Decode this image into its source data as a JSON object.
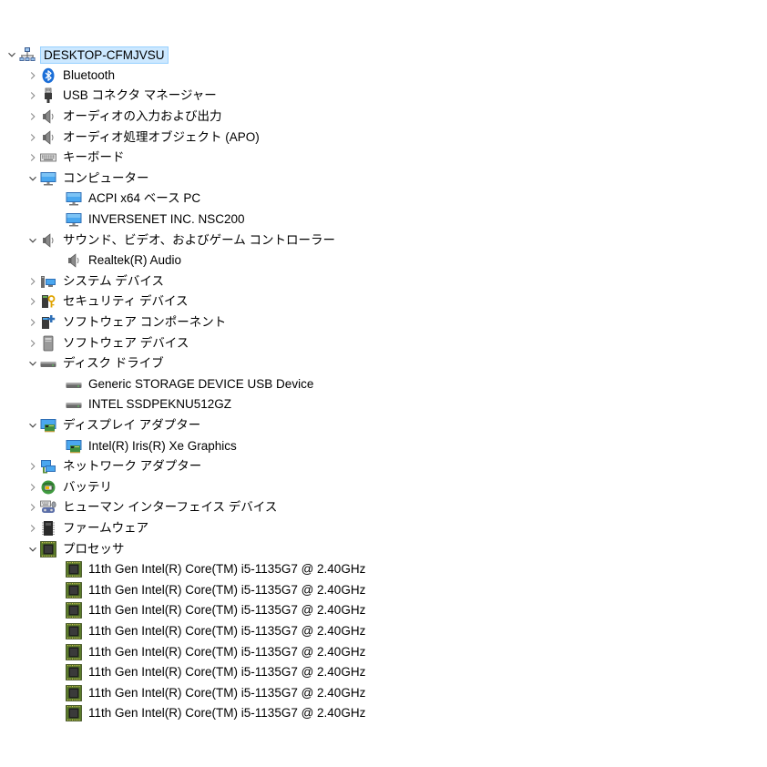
{
  "tree": {
    "root": {
      "label": "DESKTOP-CFMJVSU",
      "icon": "computer-network-icon",
      "expanded": true
    },
    "nodes": [
      {
        "label": "Bluetooth",
        "icon": "bluetooth-icon",
        "expanded": false,
        "children": []
      },
      {
        "label": "USB コネクタ マネージャー",
        "icon": "usb-connector-icon",
        "expanded": false,
        "children": []
      },
      {
        "label": "オーディオの入力および出力",
        "icon": "speaker-icon",
        "expanded": false,
        "children": []
      },
      {
        "label": "オーディオ処理オブジェクト (APO)",
        "icon": "speaker-icon",
        "expanded": false,
        "children": []
      },
      {
        "label": "キーボード",
        "icon": "keyboard-icon",
        "expanded": false,
        "children": []
      },
      {
        "label": "コンピューター",
        "icon": "monitor-icon",
        "expanded": true,
        "children": [
          {
            "label": "ACPI x64 ベース PC",
            "icon": "monitor-icon"
          },
          {
            "label": "INVERSENET INC. NSC200",
            "icon": "monitor-icon"
          }
        ]
      },
      {
        "label": "サウンド、ビデオ、およびゲーム コントローラー",
        "icon": "speaker-icon",
        "expanded": true,
        "children": [
          {
            "label": "Realtek(R) Audio",
            "icon": "speaker-icon"
          }
        ]
      },
      {
        "label": "システム デバイス",
        "icon": "system-devices-icon",
        "expanded": false,
        "children": []
      },
      {
        "label": "セキュリティ デバイス",
        "icon": "security-device-icon",
        "expanded": false,
        "children": []
      },
      {
        "label": "ソフトウェア コンポーネント",
        "icon": "software-component-icon",
        "expanded": false,
        "children": []
      },
      {
        "label": "ソフトウェア デバイス",
        "icon": "software-device-icon",
        "expanded": false,
        "children": []
      },
      {
        "label": "ディスク ドライブ",
        "icon": "disk-drive-icon",
        "expanded": true,
        "children": [
          {
            "label": "Generic STORAGE DEVICE USB Device",
            "icon": "disk-drive-icon"
          },
          {
            "label": "INTEL SSDPEKNU512GZ",
            "icon": "disk-drive-icon"
          }
        ]
      },
      {
        "label": "ディスプレイ アダプター",
        "icon": "display-adapter-icon",
        "expanded": true,
        "children": [
          {
            "label": "Intel(R) Iris(R) Xe Graphics",
            "icon": "display-adapter-icon"
          }
        ]
      },
      {
        "label": "ネットワーク アダプター",
        "icon": "network-adapter-icon",
        "expanded": false,
        "children": []
      },
      {
        "label": "バッテリ",
        "icon": "battery-icon",
        "expanded": false,
        "children": []
      },
      {
        "label": "ヒューマン インターフェイス デバイス",
        "icon": "hid-icon",
        "expanded": false,
        "children": []
      },
      {
        "label": "ファームウェア",
        "icon": "firmware-icon",
        "expanded": false,
        "children": []
      },
      {
        "label": "プロセッサ",
        "icon": "processor-icon",
        "expanded": true,
        "children": [
          {
            "label": "11th Gen Intel(R) Core(TM) i5-1135G7 @ 2.40GHz",
            "icon": "processor-icon"
          },
          {
            "label": "11th Gen Intel(R) Core(TM) i5-1135G7 @ 2.40GHz",
            "icon": "processor-icon"
          },
          {
            "label": "11th Gen Intel(R) Core(TM) i5-1135G7 @ 2.40GHz",
            "icon": "processor-icon"
          },
          {
            "label": "11th Gen Intel(R) Core(TM) i5-1135G7 @ 2.40GHz",
            "icon": "processor-icon"
          },
          {
            "label": "11th Gen Intel(R) Core(TM) i5-1135G7 @ 2.40GHz",
            "icon": "processor-icon"
          },
          {
            "label": "11th Gen Intel(R) Core(TM) i5-1135G7 @ 2.40GHz",
            "icon": "processor-icon"
          },
          {
            "label": "11th Gen Intel(R) Core(TM) i5-1135G7 @ 2.40GHz",
            "icon": "processor-icon"
          },
          {
            "label": "11th Gen Intel(R) Core(TM) i5-1135G7 @ 2.40GHz",
            "icon": "processor-icon"
          }
        ]
      }
    ]
  }
}
